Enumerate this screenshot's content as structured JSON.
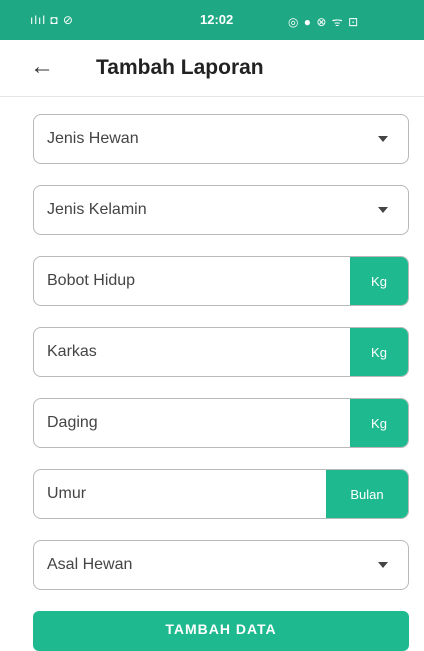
{
  "status_bar": {
    "left_icons": "ılıl ◘ ⊘",
    "time": "12:02",
    "right_icons": "◎ ● ⊗ ᯤ ⊡"
  },
  "app_bar": {
    "back_icon": "←",
    "title": "Tambah Laporan"
  },
  "form": {
    "jenis_hewan": {
      "label": "Jenis Hewan"
    },
    "jenis_kelamin": {
      "label": "Jenis Kelamin"
    },
    "bobot_hidup": {
      "label": "Bobot Hidup",
      "unit": "Kg"
    },
    "karkas": {
      "label": "Karkas",
      "unit": "Kg"
    },
    "daging": {
      "label": "Daging",
      "unit": "Kg"
    },
    "umur": {
      "label": "Umur",
      "unit": "Bulan"
    },
    "asal_hewan": {
      "label": "Asal Hewan"
    },
    "submit_label": "TAMBAH DATA"
  },
  "colors": {
    "accent": "#1fb990",
    "status_bar": "#1fa884"
  }
}
